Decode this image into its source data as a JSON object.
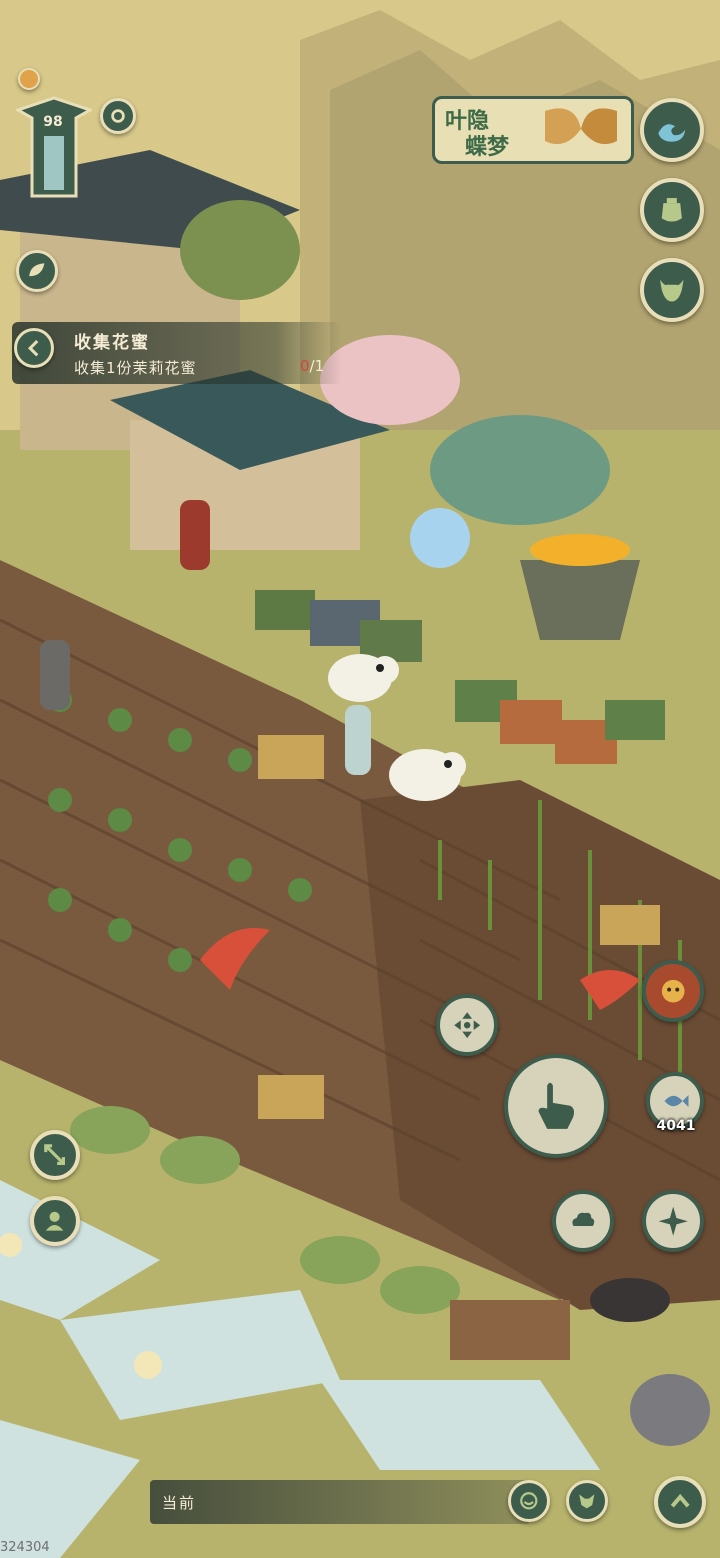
{
  "hud": {
    "level": "98",
    "event_banner": {
      "line1": "叶隐",
      "line2": "蝶梦"
    },
    "quest": {
      "title": "收集花蜜",
      "desc": "收集1份茉莉花蜜",
      "current": "0",
      "total": "/1"
    },
    "bottom_label": "当前",
    "score": "4041",
    "watermark": "324304"
  },
  "colors": {
    "hud_green": "#3e5c4c",
    "hud_cream": "#e8dfb8",
    "field_soil": "#6e4f37",
    "grass": "#b5b56a",
    "water": "#cfe2e0"
  },
  "icons": [
    "wave-icon",
    "pot-icon",
    "ox-head-icon",
    "back-arrow-icon",
    "leaf-icon",
    "expand-icon",
    "person-icon",
    "dpad-icon",
    "hand-pointer-icon",
    "cloud-icon",
    "shuriken-icon",
    "fish-icon",
    "face-icon",
    "fox-icon",
    "chevron-up-icon"
  ]
}
